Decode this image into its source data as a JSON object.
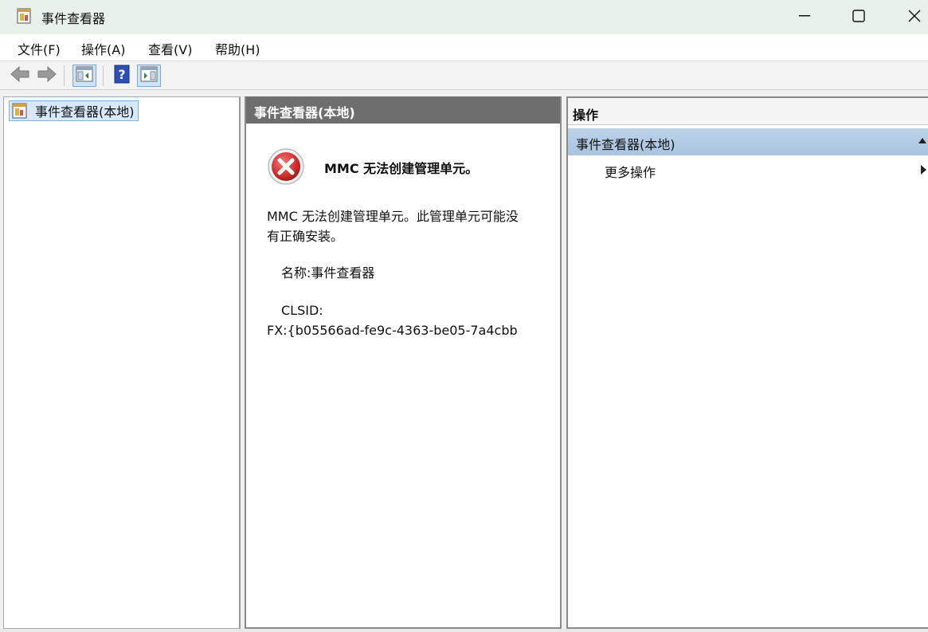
{
  "window": {
    "title": "事件查看器",
    "icon": "event-viewer-icon"
  },
  "menu": {
    "items": [
      {
        "label": "文件(F)"
      },
      {
        "label": "操作(A)"
      },
      {
        "label": "查看(V)"
      },
      {
        "label": "帮助(H)"
      }
    ]
  },
  "toolbar": {
    "icons": [
      "back-arrow-icon",
      "forward-arrow-icon",
      "show-hide-tree-icon",
      "help-icon",
      "show-hide-action-pane-icon"
    ]
  },
  "tree": {
    "root_label": "事件查看器(本地)"
  },
  "middle": {
    "header": "事件查看器(本地)",
    "error_title": "MMC 无法创建管理单元。",
    "error_body": "MMC 无法创建管理单元。此管理单元可能没有正确安装。",
    "name_line": "名称:事件查看器",
    "clsid_label": "CLSID:",
    "clsid_value": "FX:{b05566ad-fe9c-4363-be05-7a4cbb"
  },
  "actions": {
    "header": "操作",
    "section_label": "事件查看器(本地)",
    "more_actions": "更多操作"
  },
  "colors": {
    "selection_bg": "#d7e8fa",
    "header_dark": "#6e6e6e",
    "error_red": "#d32f2f"
  }
}
